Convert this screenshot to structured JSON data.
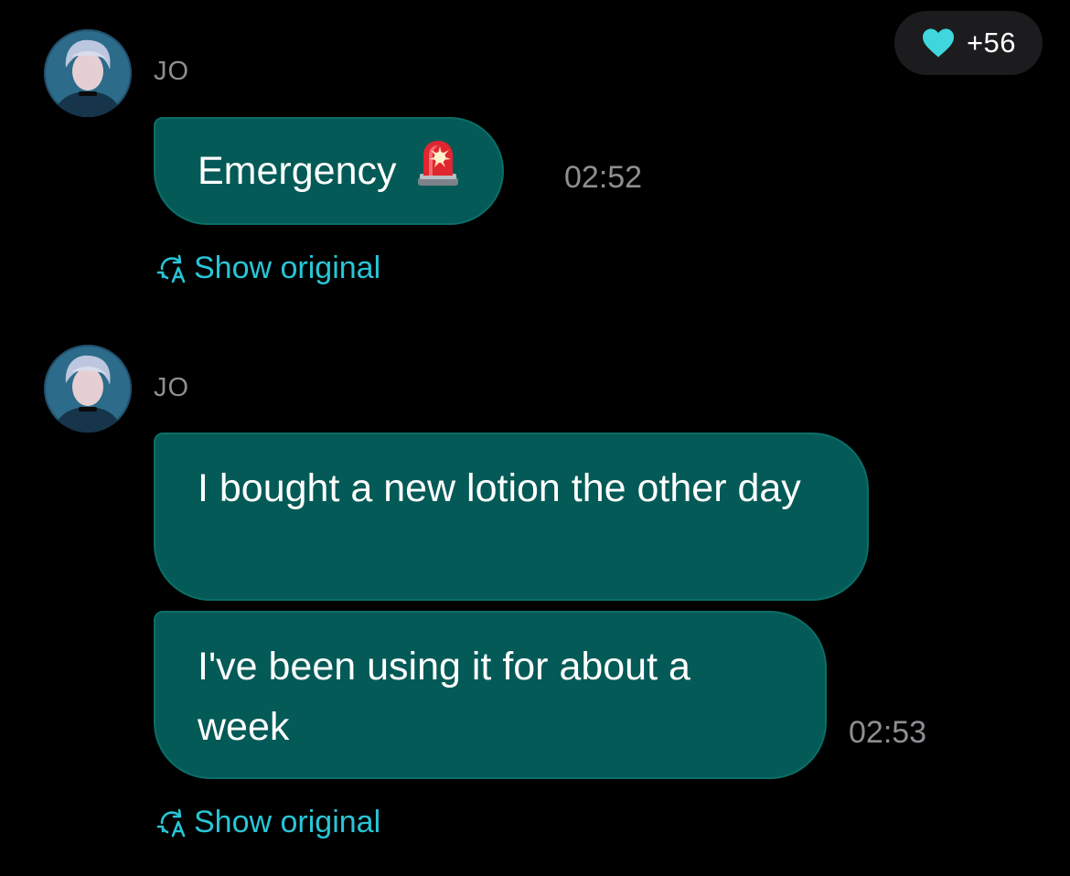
{
  "header": {
    "likes_icon": "heart-icon",
    "likes_count": "+56",
    "accent_color": "#27c6d6"
  },
  "messages": [
    {
      "sender": "JO",
      "bubbles": [
        {
          "text": "Emergency",
          "emoji": "police-light-emoji"
        }
      ],
      "time": "02:52",
      "show_original_label": "Show original"
    },
    {
      "sender": "JO",
      "bubbles": [
        {
          "text": "I bought a new lotion the other day"
        },
        {
          "text": "I've been using it for about a week"
        }
      ],
      "time": "02:53",
      "show_original_label": "Show original"
    }
  ],
  "colors": {
    "background": "#000000",
    "bubble": "#045a56",
    "link": "#27c6d6",
    "meta_text": "#8e8e93",
    "pill": "#1c1c1e"
  }
}
